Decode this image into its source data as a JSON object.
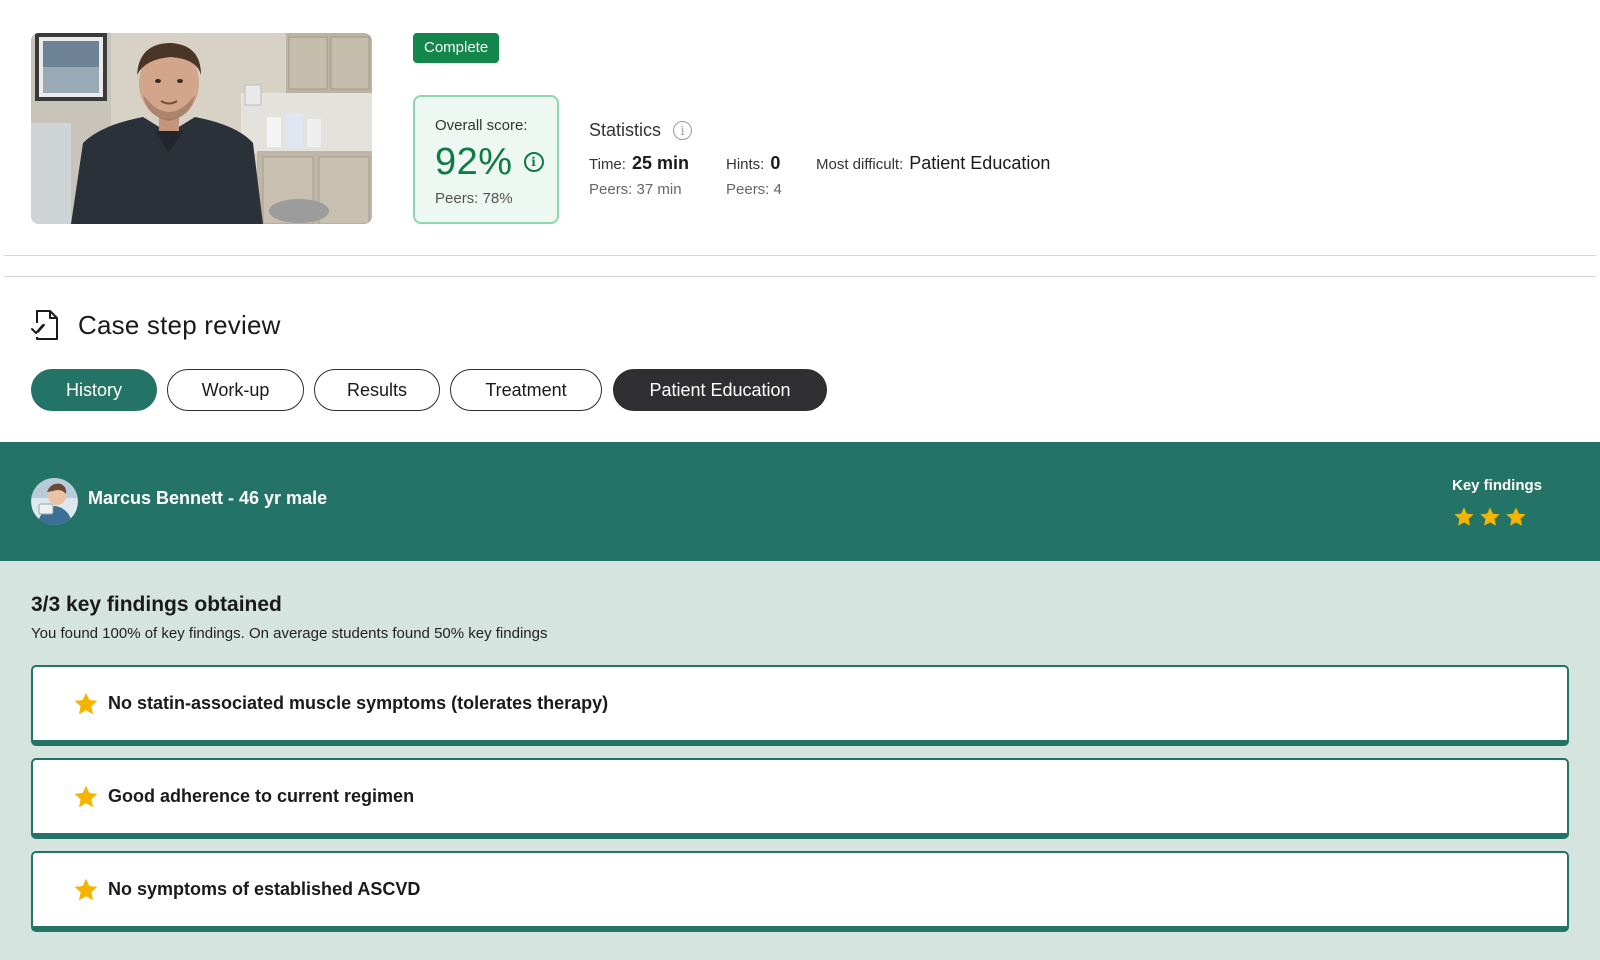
{
  "summary": {
    "status_badge": "Complete",
    "overall_score": {
      "label": "Overall score:",
      "value": "92%",
      "peers": "Peers: 78%"
    },
    "statistics": {
      "title": "Statistics",
      "time": {
        "label": "Time:",
        "value": "25 min",
        "peers": "Peers: 37 min"
      },
      "hints": {
        "label": "Hints:",
        "value": "0",
        "peers": "Peers: 4"
      },
      "most_difficult": {
        "label": "Most difficult:",
        "value": "Patient Education"
      }
    }
  },
  "case_step_review": {
    "title": "Case step review",
    "tabs": [
      {
        "label": "History",
        "state": "completed"
      },
      {
        "label": "Work-up",
        "state": "default"
      },
      {
        "label": "Results",
        "state": "default"
      },
      {
        "label": "Treatment",
        "state": "default"
      },
      {
        "label": "Patient Education",
        "state": "selected"
      }
    ]
  },
  "patient": {
    "name_line": "Marcus Bennett - 46 yr male",
    "key_findings_label": "Key findings",
    "key_findings_stars": 3
  },
  "findings": {
    "title": "3/3 key findings obtained",
    "subtitle": "You found 100% of key findings. On average students found 50% key findings",
    "items": [
      "No statin-associated muscle symptoms (tolerates therapy)",
      "Good adherence to current regimen",
      "No symptoms of established ASCVD"
    ]
  },
  "colors": {
    "brand_teal": "#237466",
    "success_green": "#13864c",
    "score_green": "#0f7a44",
    "star_gold": "#f5b400",
    "findings_bg": "#d5e4de",
    "selected_tab_dark": "#2f2f31"
  },
  "icons": {
    "case_review": "document-check-icon",
    "info": "info-icon",
    "star": "star-icon"
  }
}
